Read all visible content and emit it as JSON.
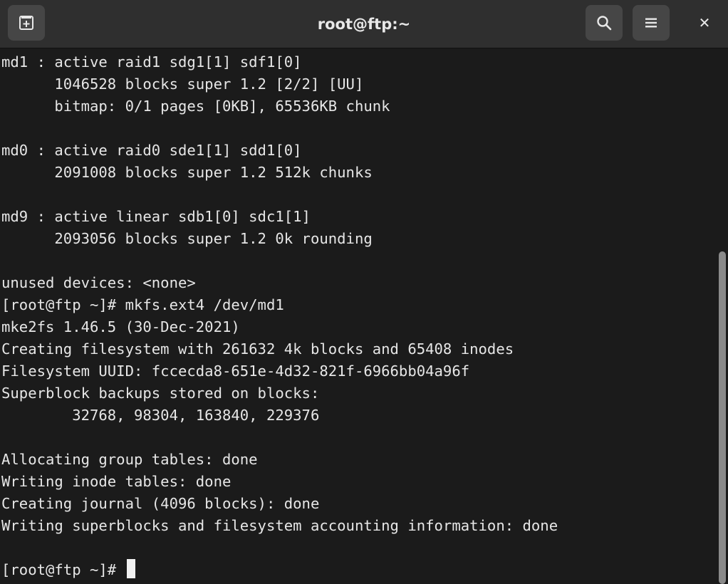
{
  "window": {
    "title": "root@ftp:~"
  },
  "toolbar": {
    "new_tab_icon": "new-tab-icon",
    "search_icon": "search-icon",
    "menu_icon": "hamburger-menu-icon",
    "close_icon": "close-icon",
    "close_glyph": "✕"
  },
  "terminal": {
    "lines": [
      "md1 : active raid1 sdg1[1] sdf1[0]",
      "      1046528 blocks super 1.2 [2/2] [UU]",
      "      bitmap: 0/1 pages [0KB], 65536KB chunk",
      "",
      "md0 : active raid0 sde1[1] sdd1[0]",
      "      2091008 blocks super 1.2 512k chunks",
      "",
      "md9 : active linear sdb1[0] sdc1[1]",
      "      2093056 blocks super 1.2 0k rounding",
      "",
      "unused devices: <none>",
      "[root@ftp ~]# mkfs.ext4 /dev/md1",
      "mke2fs 1.46.5 (30-Dec-2021)",
      "Creating filesystem with 261632 4k blocks and 65408 inodes",
      "Filesystem UUID: fccecda8-651e-4d32-821f-6966bb04a96f",
      "Superblock backups stored on blocks:",
      "        32768, 98304, 163840, 229376",
      "",
      "Allocating group tables: done",
      "Writing inode tables: done",
      "Creating journal (4096 blocks): done",
      "Writing superblocks and filesystem accounting information: done",
      "",
      "[root@ftp ~]# "
    ]
  },
  "scrollbar": {
    "thumb_start_fraction": 0.378,
    "thumb_size_fraction": 0.622
  },
  "colors": {
    "background": "#1b1b1b",
    "foreground": "#e6e6e6",
    "headerbar": "#2f2f2f",
    "button": "#464646"
  }
}
